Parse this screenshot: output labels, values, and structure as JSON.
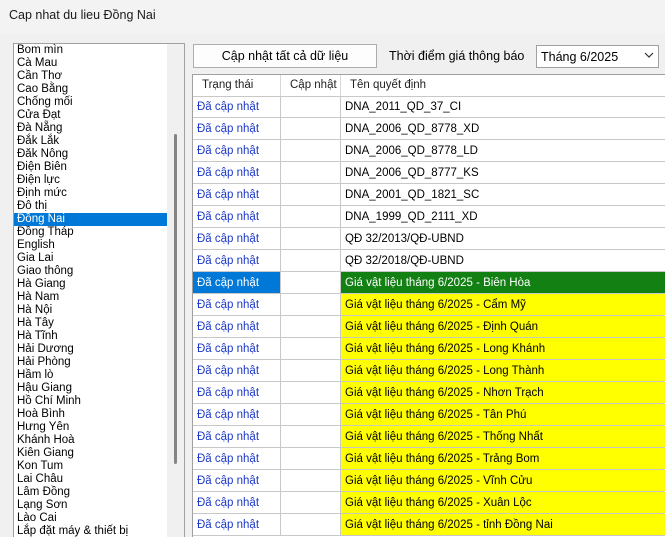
{
  "window": {
    "title": "Cap nhat du lieu Đồng Nai"
  },
  "provinces": {
    "items": [
      "Bom mìn",
      "Cà Mau",
      "Cần Thơ",
      "Cao Bằng",
      "Chống mối",
      "Cửa Đạt",
      "Đà Nẵng",
      "Đắk Lắk",
      "Đăk Nông",
      "Điện Biên",
      "Điện lực",
      "Định mức",
      "Đô thị",
      "Đồng Nai",
      "Đồng Tháp",
      "English",
      "Gia Lai",
      "Giao thông",
      "Hà Giang",
      "Hà Nam",
      "Hà Nội",
      "Hà Tây",
      "Hà Tĩnh",
      "Hải Dương",
      "Hải Phòng",
      "Hầm lò",
      "Hậu Giang",
      "Hồ Chí Minh",
      "Hoà Bình",
      "Hưng Yên",
      "Khánh Hoà",
      "Kiên Giang",
      "Kon Tum",
      "Lai Châu",
      "Lâm Đồng",
      "Lạng Sơn",
      "Lào Cai",
      "Lắp đặt máy & thiết bị"
    ],
    "selected_index": 13
  },
  "toolbar": {
    "update_all_label": "Cập nhật tất cả dữ liệu",
    "time_label": "Thời điểm giá thông báo",
    "month_value": "Tháng 6/2025"
  },
  "grid": {
    "headers": {
      "status": "Trạng thái",
      "update": "Cập nhật",
      "decision": "Tên quyết định"
    },
    "rows": [
      {
        "status": "Đã cập nhật",
        "update": "",
        "decision": "DNA_2011_QD_37_CI",
        "highlight": "none"
      },
      {
        "status": "Đã cập nhật",
        "update": "",
        "decision": "DNA_2006_QD_8778_XD",
        "highlight": "none"
      },
      {
        "status": "Đã cập nhật",
        "update": "",
        "decision": "DNA_2006_QD_8778_LD",
        "highlight": "none"
      },
      {
        "status": "Đã cập nhật",
        "update": "",
        "decision": "DNA_2006_QD_8777_KS",
        "highlight": "none"
      },
      {
        "status": "Đã cập nhật",
        "update": "",
        "decision": "DNA_2001_QD_1821_SC",
        "highlight": "none"
      },
      {
        "status": "Đã cập nhật",
        "update": "",
        "decision": "DNA_1999_QD_2111_XD",
        "highlight": "none"
      },
      {
        "status": "Đã cập nhật",
        "update": "",
        "decision": "QĐ 32/2013/QĐ-UBND",
        "highlight": "none"
      },
      {
        "status": "Đã cập nhật",
        "update": "",
        "decision": "QĐ 32/2018/QĐ-UBND",
        "highlight": "none"
      },
      {
        "status": "Đã cập nhật",
        "update": "",
        "decision": "Giá vật liệu tháng 6/2025 - Biên Hòa",
        "highlight": "selected"
      },
      {
        "status": "Đã cập nhật",
        "update": "",
        "decision": "Giá vật liệu tháng 6/2025 - Cẩm Mỹ",
        "highlight": "yellow"
      },
      {
        "status": "Đã cập nhật",
        "update": "",
        "decision": "Giá vật liệu tháng 6/2025 - Định Quán",
        "highlight": "yellow"
      },
      {
        "status": "Đã cập nhật",
        "update": "",
        "decision": "Giá vật liệu tháng 6/2025 - Long Khánh",
        "highlight": "yellow"
      },
      {
        "status": "Đã cập nhật",
        "update": "",
        "decision": "Giá vật liệu tháng 6/2025 - Long Thành",
        "highlight": "yellow"
      },
      {
        "status": "Đã cập nhật",
        "update": "",
        "decision": "Giá vật liệu tháng 6/2025 - Nhơn Trạch",
        "highlight": "yellow"
      },
      {
        "status": "Đã cập nhật",
        "update": "",
        "decision": "Giá vật liệu tháng 6/2025 - Tân Phú",
        "highlight": "yellow"
      },
      {
        "status": "Đã cập nhật",
        "update": "",
        "decision": "Giá vật liệu tháng 6/2025 - Thống Nhất",
        "highlight": "yellow"
      },
      {
        "status": "Đã cập nhật",
        "update": "",
        "decision": "Giá vật liệu tháng 6/2025 - Trảng Bom",
        "highlight": "yellow"
      },
      {
        "status": "Đã cập nhật",
        "update": "",
        "decision": "Giá vật liệu tháng 6/2025 - Vĩnh Cửu",
        "highlight": "yellow"
      },
      {
        "status": "Đã cập nhật",
        "update": "",
        "decision": "Giá vật liệu tháng 6/2025 - Xuân Lộc",
        "highlight": "yellow"
      },
      {
        "status": "Đã cập nhật",
        "update": "",
        "decision": "Giá vật liệu tháng 6/2025 - tỉnh Đồng Nai",
        "highlight": "yellow"
      }
    ]
  },
  "colors": {
    "selection_blue": "#0078d7",
    "status_text": "#1a37c9",
    "highlight_yellow": "#ffff00",
    "highlight_green": "#138013"
  }
}
